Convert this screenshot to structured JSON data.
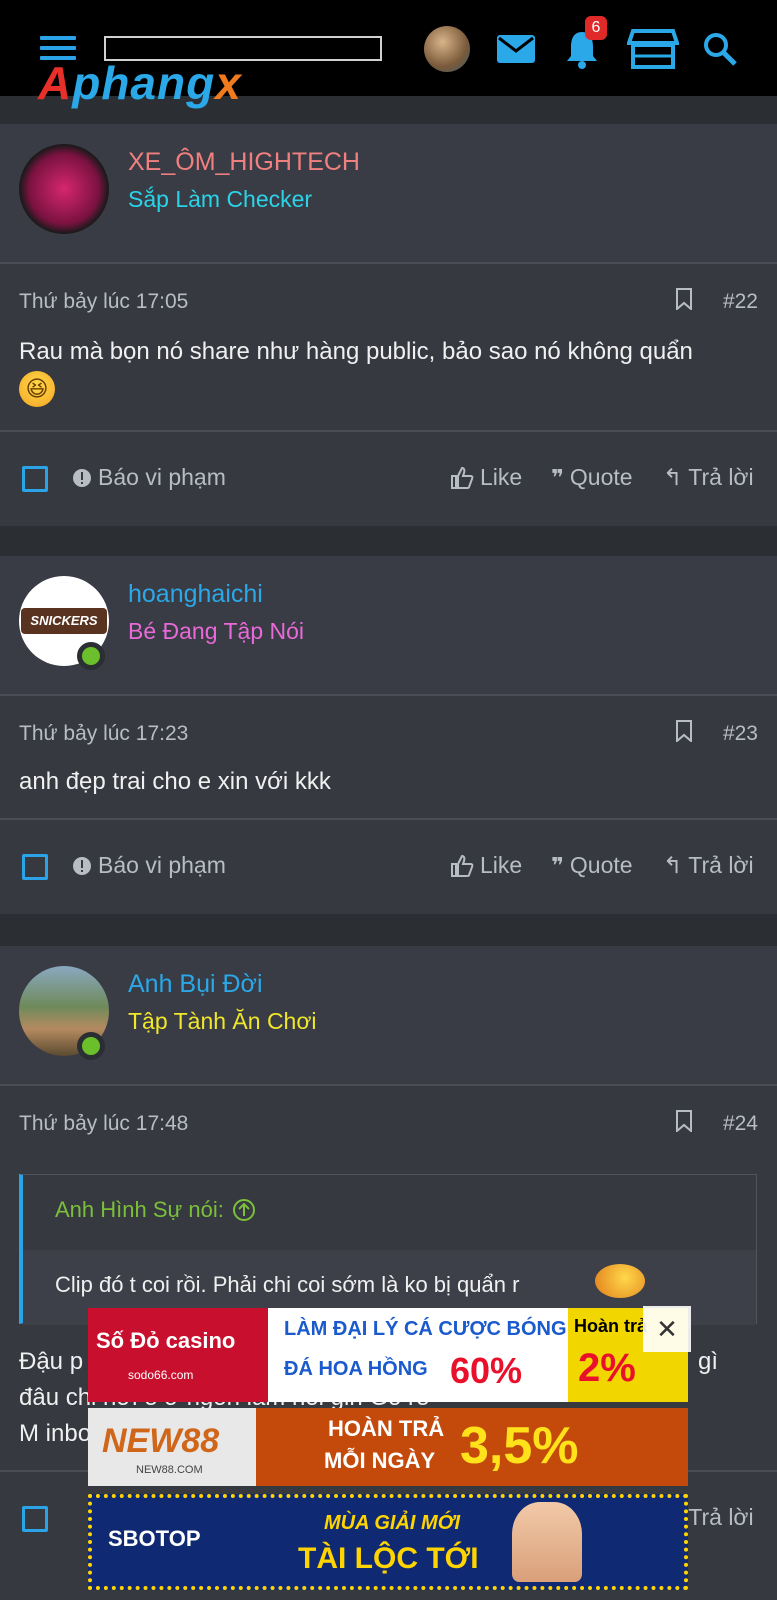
{
  "nav": {
    "logo": {
      "part1": "A",
      "part2": "phang",
      "part3": "x"
    },
    "notification_count": "6"
  },
  "posts": [
    {
      "author_name": "XE_ÔM_HIGHTECH",
      "author_title": "Sắp Làm Checker",
      "name_color": "#f08080",
      "title_color": "#2ad4e8",
      "date": "Thứ bảy lúc 17:05",
      "number": "#22",
      "content": "Rau mà bọn nó share như hàng public, bảo sao nó không quẩn",
      "emoji": "😆",
      "online": false
    },
    {
      "author_name": "hoanghaichi",
      "author_title": "Bé Đang Tập Nói",
      "name_color": "#2aa8e8",
      "title_color": "#e86ad8",
      "date": "Thứ bảy lúc 17:23",
      "number": "#23",
      "content": "anh đẹp trai cho e xin với kkk",
      "online": true
    },
    {
      "author_name": "Anh Bụi Đời",
      "author_title": "Tập Tành Ăn Chơi",
      "name_color": "#2aa8e8",
      "title_color": "#f0e62a",
      "date": "Thứ bảy lúc 17:48",
      "number": "#24",
      "quote_author": "Anh Hình Sự nói:",
      "quote_text": "Clip đó t coi rồi. Phải chi coi sớm là ko bị quẩn r",
      "content_lines": [
        "Đậu p",
        "đâu chi nơi e ơ ngon lam noi gin Go re",
        "M inbo"
      ],
      "content_tail": "gì",
      "online": true
    }
  ],
  "actions": {
    "report": "Báo vi phạm",
    "like": "Like",
    "quote": "Quote",
    "reply": "Trả lời"
  },
  "ads": [
    {
      "brand": "Số Đỏ casino",
      "site": "sodo66.com",
      "line1": "LÀM ĐẠI LÝ CÁ CƯỢC BÓNG",
      "line2": "ĐÁ HOA HỒNG",
      "percent": "60%",
      "side_label": "Hoàn trả",
      "side_percent": "2%"
    },
    {
      "brand": "NEW88",
      "site": "NEW88.COM",
      "line1": "HOÀN TRẢ",
      "line2": "MỖI NGÀY",
      "percent": "3,5%"
    },
    {
      "brand": "SBOTOP",
      "line1": "MÙA GIẢI MỚI",
      "line2": "TÀI LỘC TỚI"
    }
  ]
}
